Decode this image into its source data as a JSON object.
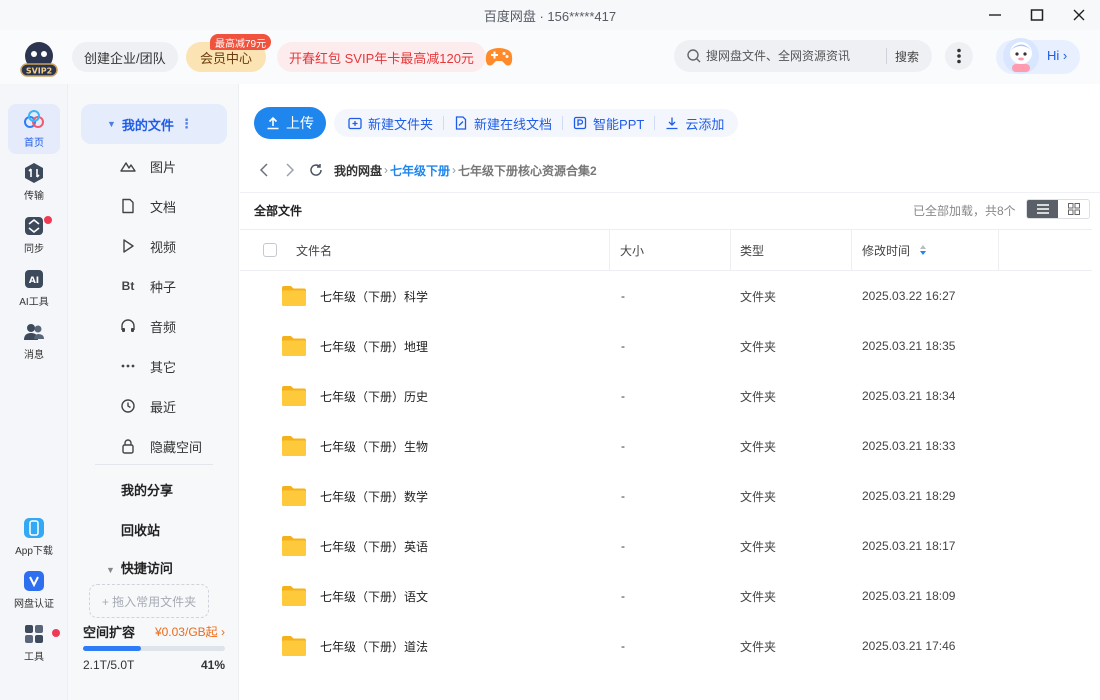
{
  "window": {
    "title": "百度网盘 · 156*****417"
  },
  "header": {
    "logo_text": "SVIP2",
    "create_team": "创建企业/团队",
    "vip_center": "会员中心",
    "vip_badge": "最高减79元",
    "promo": "开春红包 SVIP年卡最高减120元",
    "search_placeholder": "搜网盘文件、全网资源资讯",
    "search_button": "搜索",
    "greeting": "Hi"
  },
  "rail": {
    "home": "首页",
    "transfer": "传输",
    "sync": "同步",
    "ai_tools": "AI工具",
    "messages": "消息",
    "app_download": "App下载",
    "verify": "网盘认证",
    "tools": "工具"
  },
  "sidebar": {
    "my_files": "我的文件",
    "categories": [
      {
        "label": "图片",
        "icon": "image-icon"
      },
      {
        "label": "文档",
        "icon": "document-icon"
      },
      {
        "label": "视频",
        "icon": "video-icon"
      },
      {
        "label": "种子",
        "icon": "torrent-icon"
      },
      {
        "label": "音频",
        "icon": "audio-icon"
      },
      {
        "label": "其它",
        "icon": "more-icon"
      },
      {
        "label": "最近",
        "icon": "recent-icon"
      },
      {
        "label": "隐藏空间",
        "icon": "lock-icon"
      }
    ],
    "torrent_glyph": "Bt",
    "my_shares": "我的分享",
    "recycle_bin": "回收站",
    "quick_access": "快捷访问",
    "drop_zone": "+ 拖入常用文件夹",
    "space_title": "空间扩容",
    "space_price": "¥0.03/GB起",
    "space_used": "2.1T/5.0T",
    "space_percent": "41%",
    "space_fraction": 0.41
  },
  "toolbar": {
    "upload": "上传",
    "new_folder": "新建文件夹",
    "new_online_doc": "新建在线文档",
    "smart_ppt": "智能PPT",
    "cloud_add": "云添加"
  },
  "breadcrumb": {
    "root": "我的网盘",
    "middle": "七年级下册",
    "current": "七年级下册核心资源合集2"
  },
  "list": {
    "title": "全部文件",
    "status": "已全部加载，共8个",
    "columns": {
      "name": "文件名",
      "size": "大小",
      "type": "类型",
      "modified": "修改时间"
    },
    "rows": [
      {
        "name": "七年级（下册）科学",
        "size": "-",
        "type": "文件夹",
        "modified": "2025.03.22 16:27"
      },
      {
        "name": "七年级（下册）地理",
        "size": "-",
        "type": "文件夹",
        "modified": "2025.03.21 18:35"
      },
      {
        "name": "七年级（下册）历史",
        "size": "-",
        "type": "文件夹",
        "modified": "2025.03.21 18:34"
      },
      {
        "name": "七年级（下册）生物",
        "size": "-",
        "type": "文件夹",
        "modified": "2025.03.21 18:33"
      },
      {
        "name": "七年级（下册）数学",
        "size": "-",
        "type": "文件夹",
        "modified": "2025.03.21 18:29"
      },
      {
        "name": "七年级（下册）英语",
        "size": "-",
        "type": "文件夹",
        "modified": "2025.03.21 18:17"
      },
      {
        "name": "七年级（下册）语文",
        "size": "-",
        "type": "文件夹",
        "modified": "2025.03.21 18:09"
      },
      {
        "name": "七年级（下册）道法",
        "size": "-",
        "type": "文件夹",
        "modified": "2025.03.21 17:46"
      }
    ]
  },
  "colors": {
    "accent": "#1f86ee",
    "brand_blue": "#1f5de8",
    "folder": "#ffc533",
    "danger": "#f03a53"
  }
}
